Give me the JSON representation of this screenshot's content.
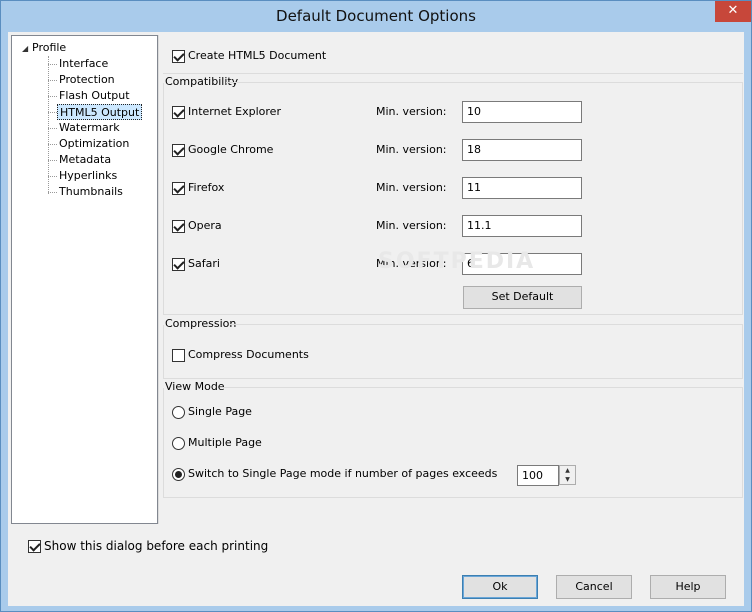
{
  "window": {
    "title": "Default Document Options",
    "close_glyph": "✕"
  },
  "tree": {
    "root": "Profile",
    "children": [
      "Interface",
      "Protection",
      "Flash Output",
      "HTML5 Output",
      "Watermark",
      "Optimization",
      "Metadata",
      "Hyperlinks",
      "Thumbnails"
    ],
    "selected": "HTML5 Output"
  },
  "html5": {
    "create_label": "Create HTML5 Document",
    "create_checked": true
  },
  "compatibility": {
    "group_label": "Compatibility",
    "min_version_label": "Min. version:",
    "browsers": [
      {
        "name": "Internet Explorer",
        "checked": true,
        "version": "10"
      },
      {
        "name": "Google Chrome",
        "checked": true,
        "version": "18"
      },
      {
        "name": "Firefox",
        "checked": true,
        "version": "11"
      },
      {
        "name": "Opera",
        "checked": true,
        "version": "11.1"
      },
      {
        "name": "Safari",
        "checked": true,
        "version": "6"
      }
    ],
    "set_default_label": "Set Default"
  },
  "compression": {
    "group_label": "Compression",
    "compress_label": "Compress Documents",
    "compress_checked": false
  },
  "view_mode": {
    "group_label": "View Mode",
    "options": [
      {
        "label": "Single Page",
        "selected": false
      },
      {
        "label": "Multiple Page",
        "selected": false
      },
      {
        "label": "Switch to Single Page mode if number of pages exceeds",
        "selected": true
      }
    ],
    "pages_value": "100"
  },
  "footer": {
    "show_dialog_label": "Show this dialog before each printing",
    "show_dialog_checked": true,
    "ok_label": "Ok",
    "cancel_label": "Cancel",
    "help_label": "Help"
  },
  "watermark_text": "SOFTPEDIA"
}
